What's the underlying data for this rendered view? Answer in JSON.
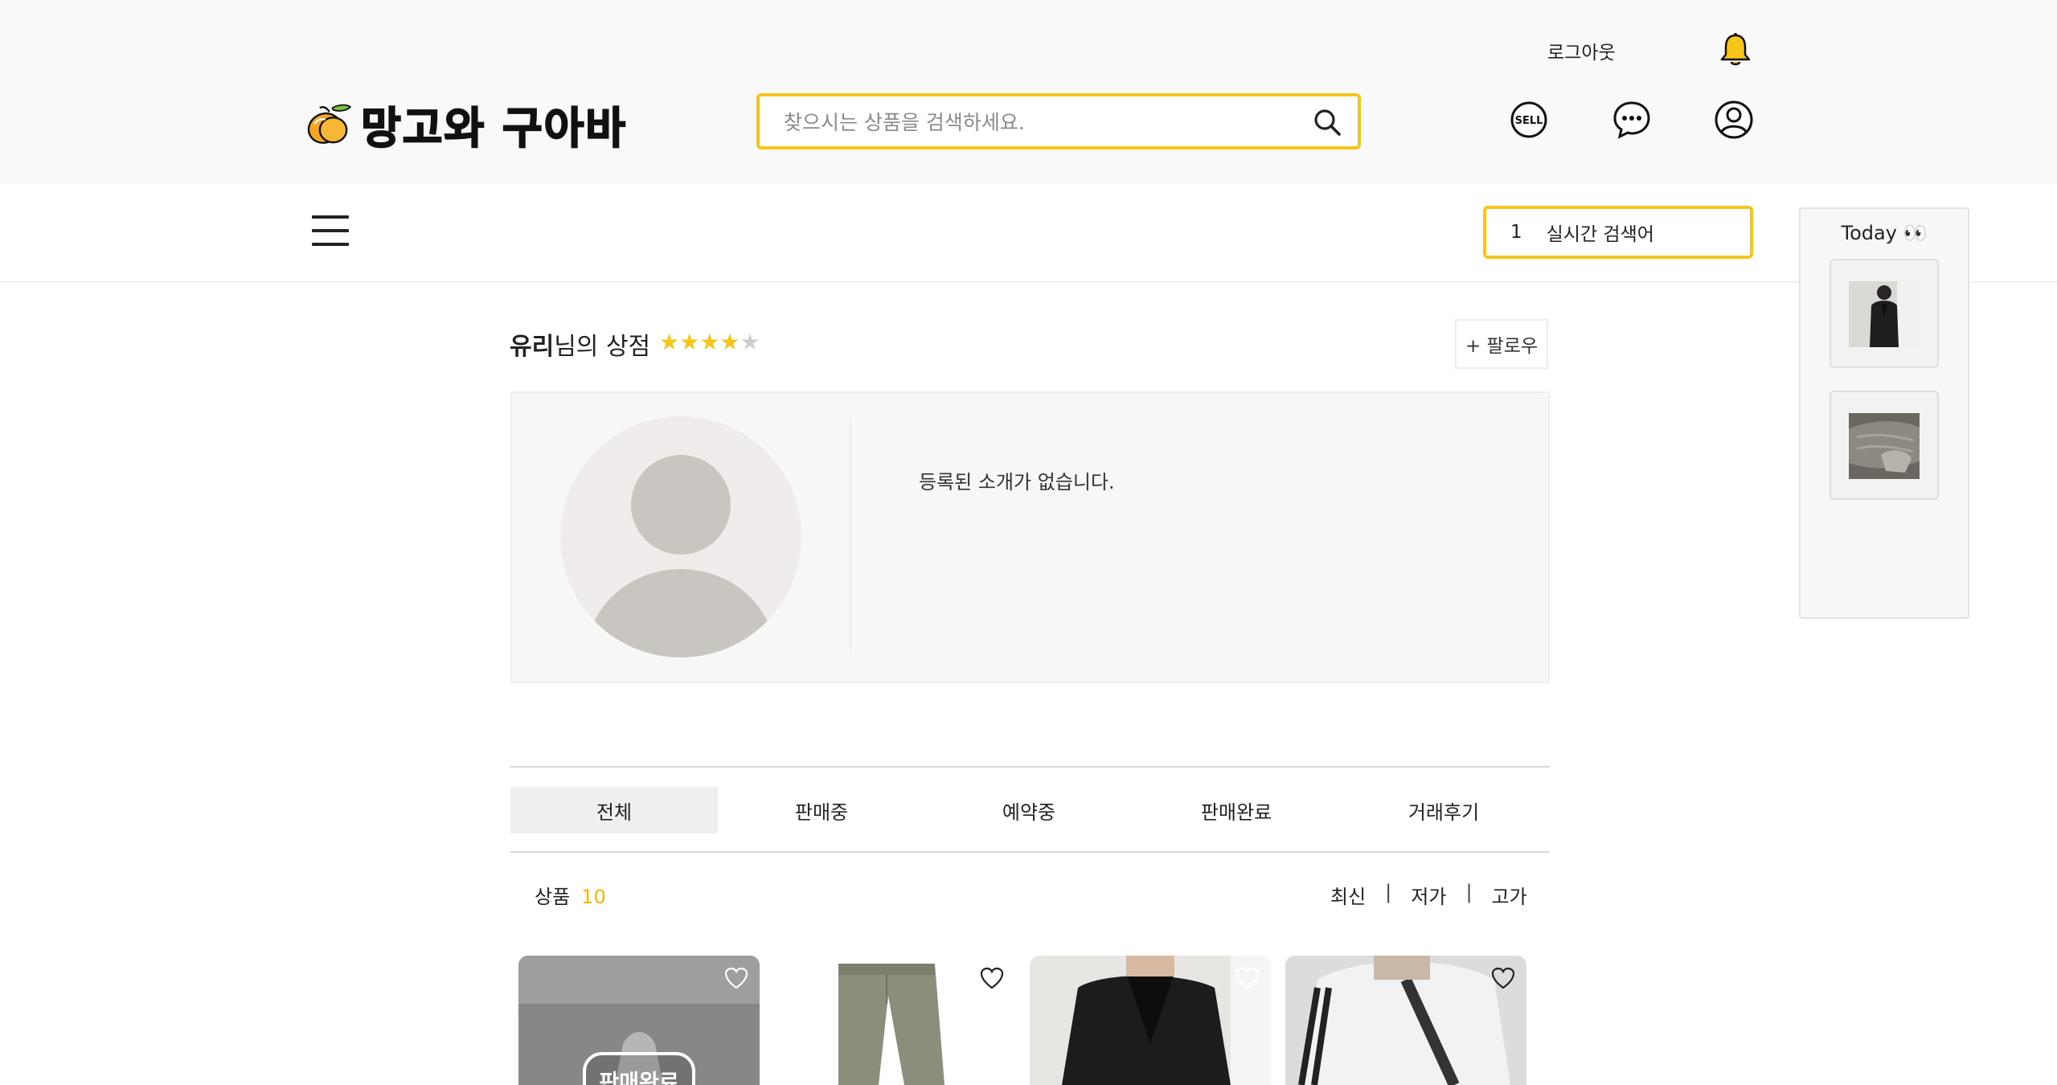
{
  "header": {
    "logo_text": "망고와 구아바",
    "search_placeholder": "찾으시는 상품을 검색하세요.",
    "logout_label": "로그아웃",
    "icons": [
      "mango-logo-icon",
      "search-icon",
      "bell-icon",
      "sell-icon",
      "chat-icon",
      "user-icon"
    ]
  },
  "subbar": {
    "realtime_rank": "1",
    "realtime_label": "실시간 검색어"
  },
  "today_panel": {
    "title": "Today 👀",
    "items": [
      {
        "name": "black-jacket-thumb"
      },
      {
        "name": "knit-sweater-thumb"
      }
    ]
  },
  "store": {
    "owner_name": "유리",
    "title_suffix": "님의 상점",
    "rating": 4,
    "rating_max": 5,
    "follow_label": "+ 팔로우",
    "intro_text": "등록된 소개가 없습니다."
  },
  "tabs": [
    {
      "label": "전체",
      "active": true
    },
    {
      "label": "판매중",
      "active": false
    },
    {
      "label": "예약중",
      "active": false
    },
    {
      "label": "판매완료",
      "active": false
    },
    {
      "label": "거래후기",
      "active": false
    }
  ],
  "listing": {
    "count_label": "상품",
    "count_value": "10",
    "sort": [
      "최신",
      "저가",
      "고가"
    ],
    "sort_separator": "|"
  },
  "products": [
    {
      "status_badge": "판매완료",
      "image": "sold-item-photo"
    },
    {
      "status_badge": "",
      "image": "khaki-pants-photo"
    },
    {
      "status_badge": "",
      "image": "black-blazer-photo"
    },
    {
      "status_badge": "",
      "image": "white-track-jacket-photo"
    }
  ],
  "colors": {
    "accent": "#f5c518",
    "count": "#f5b800",
    "header_bg": "#f9f9f9",
    "panel_bg": "#f7f7f7"
  }
}
